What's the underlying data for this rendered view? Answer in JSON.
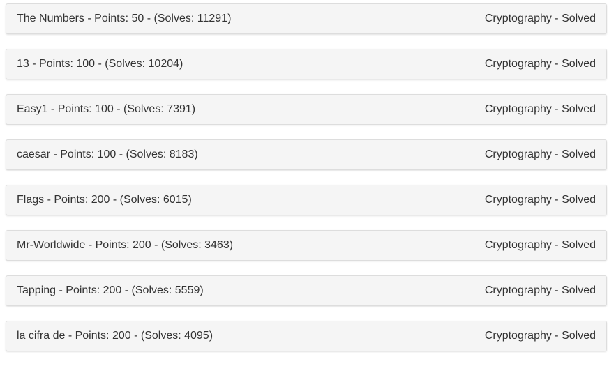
{
  "challenges": [
    {
      "title": "The Numbers - Points: 50 - (Solves: 11291)",
      "status": "Cryptography - Solved"
    },
    {
      "title": "13 - Points: 100 - (Solves: 10204)",
      "status": "Cryptography - Solved"
    },
    {
      "title": "Easy1 - Points: 100 - (Solves: 7391)",
      "status": "Cryptography - Solved"
    },
    {
      "title": "caesar - Points: 100 - (Solves: 8183)",
      "status": "Cryptography - Solved"
    },
    {
      "title": "Flags - Points: 200 - (Solves: 6015)",
      "status": "Cryptography - Solved"
    },
    {
      "title": "Mr-Worldwide - Points: 200 - (Solves: 3463)",
      "status": "Cryptography - Solved"
    },
    {
      "title": "Tapping - Points: 200 - (Solves: 5559)",
      "status": "Cryptography - Solved"
    },
    {
      "title": "la cifra de - Points: 200 - (Solves: 4095)",
      "status": "Cryptography - Solved"
    }
  ]
}
